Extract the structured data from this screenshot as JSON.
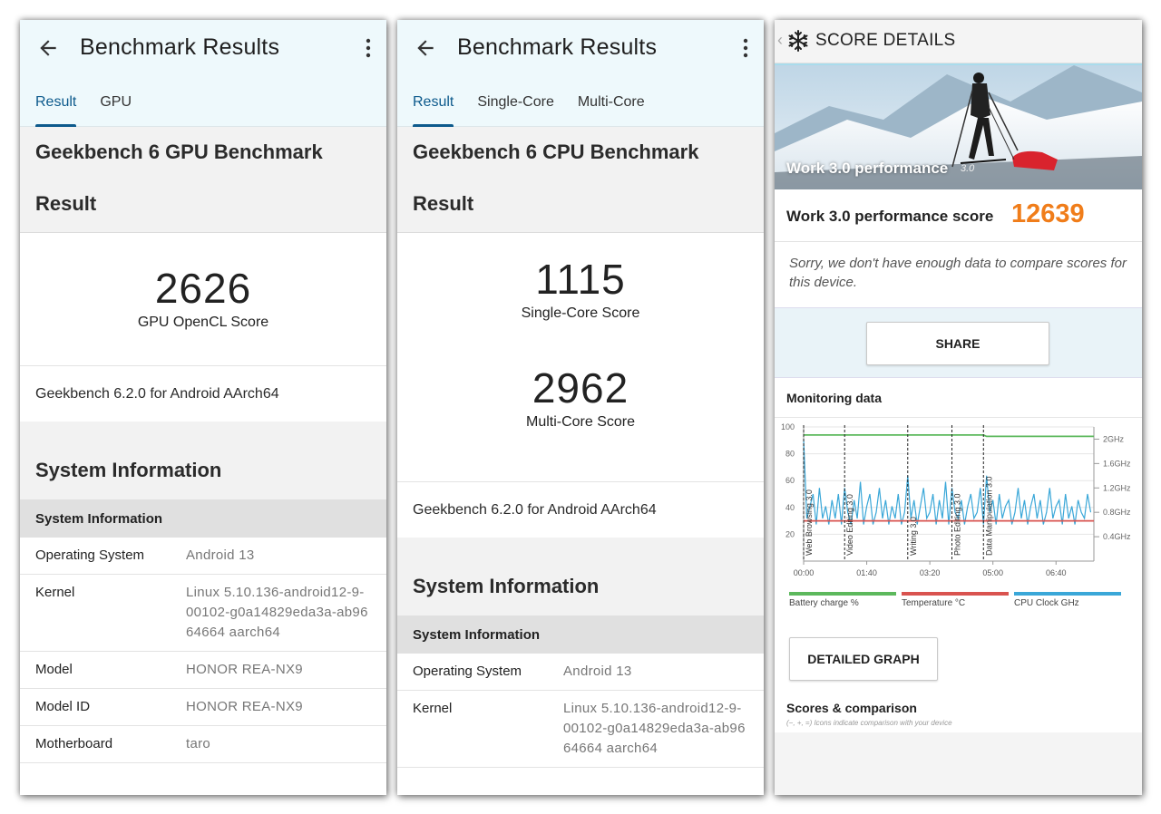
{
  "gpu_screen": {
    "app_title": "Benchmark Results",
    "tabs": [
      {
        "label": "Result",
        "active": true
      },
      {
        "label": "GPU",
        "active": false
      }
    ],
    "benchmark_title": "Geekbench 6 GPU Benchmark",
    "result_label": "Result",
    "score": "2626",
    "score_label": "GPU OpenCL Score",
    "version": "Geekbench 6.2.0 for Android AArch64",
    "system_title": "System Information",
    "system_subtitle": "System Information",
    "system_info": [
      {
        "key": "Operating System",
        "value": "Android 13"
      },
      {
        "key": "Kernel",
        "value": "Linux 5.10.136-android12-9-00102-g0a14829eda3a-ab9664664 aarch64"
      },
      {
        "key": "Model",
        "value": "HONOR REA-NX9"
      },
      {
        "key": "Model ID",
        "value": "HONOR REA-NX9"
      },
      {
        "key": "Motherboard",
        "value": "taro"
      }
    ]
  },
  "cpu_screen": {
    "app_title": "Benchmark Results",
    "tabs": [
      {
        "label": "Result",
        "active": true
      },
      {
        "label": "Single-Core",
        "active": false
      },
      {
        "label": "Multi-Core",
        "active": false
      }
    ],
    "benchmark_title": "Geekbench 6 CPU Benchmark",
    "result_label": "Result",
    "single_score": "1115",
    "single_label": "Single-Core Score",
    "multi_score": "2962",
    "multi_label": "Multi-Core Score",
    "version": "Geekbench 6.2.0 for Android AArch64",
    "system_title": "System Information",
    "system_subtitle": "System Information",
    "system_info": [
      {
        "key": "Operating System",
        "value": "Android 13"
      },
      {
        "key": "Kernel",
        "value": "Linux 5.10.136-android12-9-00102-g0a14829eda3a-ab9664664 aarch64"
      }
    ]
  },
  "score_screen": {
    "header_title": "SCORE DETAILS",
    "hero_label": "Work 3.0 performance",
    "hero_version": "3.0",
    "perf_label": "Work 3.0 performance score",
    "perf_score": "12639",
    "sorry_text": "Sorry, we don't have enough data to compare scores for this device.",
    "share_label": "SHARE",
    "monitoring_title": "Monitoring data",
    "detailed_graph_label": "DETAILED GRAPH",
    "scores_title": "Scores & comparison",
    "scores_note": "(−, +, =) Icons indicate comparison with your device",
    "legend": [
      {
        "label": "Battery charge %",
        "color": "#5cb85c"
      },
      {
        "label": "Temperature °C",
        "color": "#d9534f"
      },
      {
        "label": "CPU Clock GHz",
        "color": "#3aa7d8"
      }
    ],
    "colors": {
      "score_orange": "#f07d1a",
      "battery": "#5cb85c",
      "temperature": "#d9534f",
      "cpu": "#3aa7d8"
    }
  },
  "chart_data": {
    "type": "line",
    "title": "Monitoring data",
    "xlabel": "",
    "ylabel": "",
    "x_ticks": [
      "00:00",
      "01:40",
      "03:20",
      "05:00",
      "06:40"
    ],
    "y_left_ticks": [
      "20",
      "40",
      "60",
      "80",
      "100"
    ],
    "y_right_ticks": [
      "0.4GHz",
      "0.8GHz",
      "1.2GHz",
      "1.6GHz",
      "2GHz"
    ],
    "ylim_left": [
      0,
      100
    ],
    "ylim_right_ghz": [
      0,
      2.2
    ],
    "x_range_seconds": [
      0,
      460
    ],
    "sections": [
      {
        "label": "Web Browsing 3.0",
        "start": 0
      },
      {
        "label": "Video Editing 3.0",
        "start": 65
      },
      {
        "label": "Writing 3.0",
        "start": 165
      },
      {
        "label": "Photo Editing 3.0",
        "start": 235
      },
      {
        "label": "Data Manipulation 3.0",
        "start": 285
      }
    ],
    "series": [
      {
        "name": "Battery charge %",
        "axis": "left",
        "x": [
          0,
          165,
          166,
          285,
          290,
          460
        ],
        "y": [
          94,
          94,
          94,
          94,
          93,
          93
        ]
      },
      {
        "name": "Temperature °C",
        "axis": "left",
        "x": [
          0,
          460
        ],
        "y": [
          30,
          30
        ]
      },
      {
        "name": "CPU Clock GHz",
        "axis": "right",
        "x": [
          0,
          5,
          10,
          15,
          20,
          25,
          30,
          35,
          40,
          45,
          50,
          55,
          60,
          65,
          70,
          75,
          80,
          85,
          90,
          95,
          100,
          105,
          110,
          115,
          120,
          125,
          130,
          135,
          140,
          145,
          150,
          155,
          160,
          165,
          170,
          175,
          180,
          185,
          190,
          195,
          200,
          205,
          210,
          215,
          220,
          225,
          230,
          235,
          240,
          245,
          250,
          255,
          260,
          265,
          270,
          275,
          280,
          285,
          290,
          295,
          300,
          305,
          310,
          315,
          320,
          325,
          330,
          335,
          340,
          345,
          350,
          355,
          360,
          365,
          370,
          375,
          380,
          385,
          390,
          395,
          400,
          405,
          410,
          415,
          420,
          425,
          430,
          435,
          440,
          445,
          450,
          455
        ],
        "y": [
          2.0,
          0.7,
          0.9,
          1.1,
          0.6,
          1.2,
          0.7,
          0.9,
          0.6,
          1.0,
          0.7,
          1.1,
          0.6,
          1.2,
          0.8,
          0.6,
          1.0,
          0.7,
          1.3,
          0.6,
          0.9,
          1.1,
          0.6,
          0.8,
          1.2,
          0.7,
          1.0,
          0.6,
          0.9,
          0.7,
          1.1,
          0.6,
          0.8,
          1.4,
          0.7,
          1.0,
          0.6,
          0.9,
          1.2,
          0.7,
          0.8,
          1.1,
          0.6,
          1.0,
          0.7,
          1.3,
          0.6,
          1.2,
          0.8,
          0.7,
          1.0,
          0.6,
          0.9,
          1.1,
          0.7,
          0.8,
          1.2,
          0.6,
          1.4,
          0.8,
          1.0,
          0.6,
          1.1,
          0.7,
          0.9,
          1.0,
          0.6,
          0.8,
          1.2,
          0.7,
          1.0,
          0.6,
          0.9,
          1.1,
          0.7,
          1.0,
          0.6,
          0.8,
          1.2,
          0.7,
          0.9,
          1.0,
          0.6,
          1.1,
          0.7,
          0.9,
          0.6,
          1.0,
          0.8,
          0.7,
          1.1,
          0.8
        ]
      }
    ]
  }
}
